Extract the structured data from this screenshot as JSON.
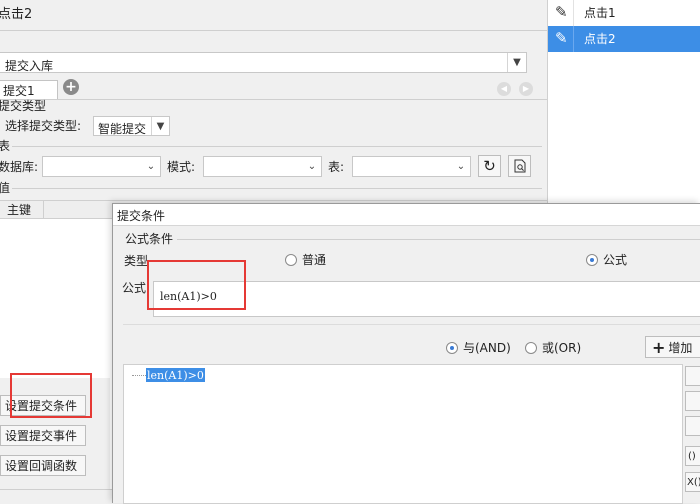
{
  "window": {
    "title": "点击2"
  },
  "action_select": {
    "value": "提交入库"
  },
  "tabs": [
    {
      "label": "提交1"
    }
  ],
  "submit_type": {
    "section": "提交类型",
    "label": "选择提交类型:",
    "value": "智能提交"
  },
  "table_section": {
    "section": "表",
    "db_label": "数据库:",
    "db_value": "",
    "mode_label": "模式:",
    "mode_value": "",
    "table_label": "表:",
    "table_value": ""
  },
  "value_section": {
    "section": "值",
    "col_primary": "主键"
  },
  "buttons": {
    "set_condition": "设置提交条件",
    "set_event": "设置提交事件",
    "set_callback": "设置回调函数"
  },
  "event_list": {
    "items": [
      {
        "label": "点击1",
        "icon": "pencil-icon",
        "selected": false
      },
      {
        "label": "点击2",
        "icon": "pencil-icon",
        "selected": true
      }
    ],
    "selected_color": "#3d8ee6"
  },
  "dialog": {
    "title": "提交条件",
    "group": "公式条件",
    "type_label": "类型",
    "radio_normal": "普通",
    "radio_formula": "公式",
    "formula_label": "公式",
    "formula_value": "len(A1)>0",
    "logic_and": "与(AND)",
    "logic_or": "或(OR)",
    "add_button": "增加",
    "conditions": [
      "len(A1)>0"
    ],
    "side_buttons": [
      "()",
      "X()"
    ]
  },
  "annotation_color": "#e53935"
}
